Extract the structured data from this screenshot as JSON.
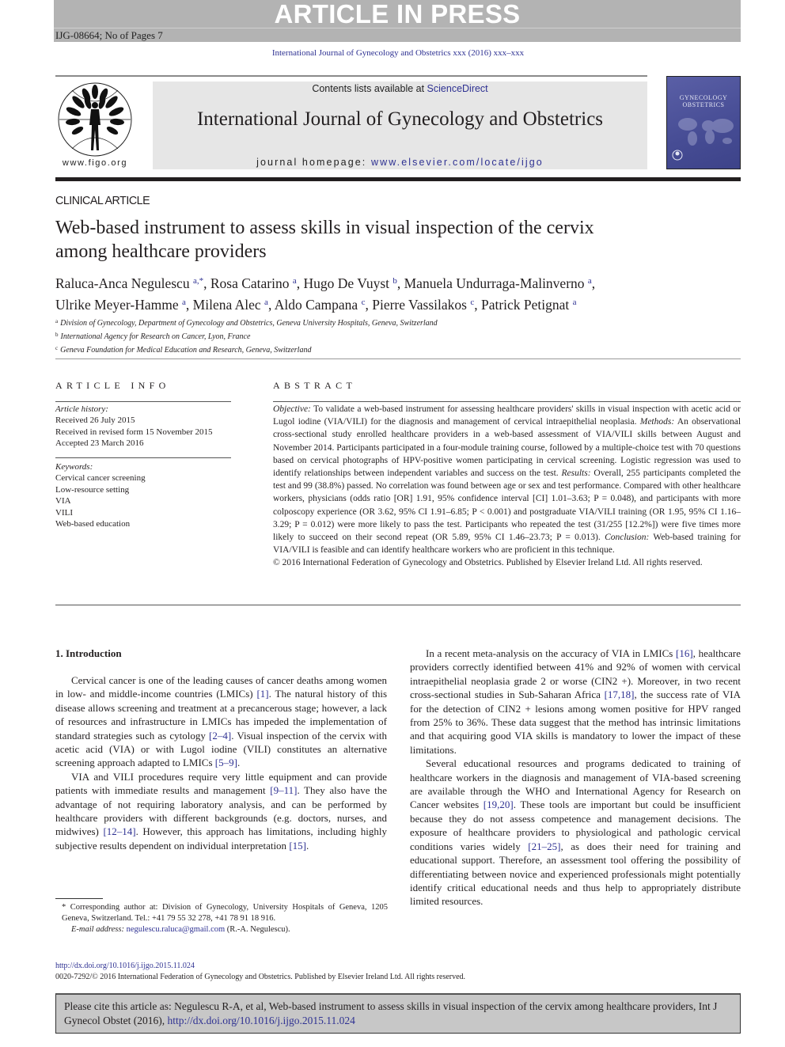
{
  "banner": {
    "article_in_press": "ARTICLE IN PRESS",
    "manuscript_id": "IJG-08664; No of Pages 7"
  },
  "journal_ref": "International Journal of Gynecology and Obstetrics xxx (2016) xxx–xxx",
  "header": {
    "figo_url": "www.figo.org",
    "contents_prefix": "Contents lists available at ",
    "contents_link": "ScienceDirect",
    "journal_title": "International Journal of Gynecology and Obstetrics",
    "homepage_prefix": "journal homepage: ",
    "homepage_link": "www.elsevier.com/locate/ijgo",
    "cover_line1": "GYNECOLOGY",
    "cover_line2": "OBSTETRICS"
  },
  "article": {
    "type": "CLINICAL ARTICLE",
    "title_line1": "Web-based instrument to assess skills in visual inspection of the cervix",
    "title_line2": "among healthcare providers",
    "authors": [
      {
        "name": "Raluca-Anca Negulescu",
        "aff": "a,*"
      },
      {
        "name": "Rosa Catarino",
        "aff": "a"
      },
      {
        "name": "Hugo De Vuyst",
        "aff": "b"
      },
      {
        "name": "Manuela Undurraga-Malinverno",
        "aff": "a"
      },
      {
        "name": "Ulrike Meyer-Hamme",
        "aff": "a"
      },
      {
        "name": "Milena Alec",
        "aff": "a"
      },
      {
        "name": "Aldo Campana",
        "aff": "c"
      },
      {
        "name": "Pierre Vassilakos",
        "aff": "c"
      },
      {
        "name": "Patrick Petignat",
        "aff": "a"
      }
    ],
    "affiliations": [
      {
        "mark": "a",
        "text": "Division of Gynecology, Department of Gynecology and Obstetrics, Geneva University Hospitals, Geneva, Switzerland"
      },
      {
        "mark": "b",
        "text": "International Agency for Research on Cancer, Lyon, France"
      },
      {
        "mark": "c",
        "text": "Geneva Foundation for Medical Education and Research, Geneva, Switzerland"
      }
    ]
  },
  "article_info": {
    "heading": "ARTICLE INFO",
    "history_label": "Article history:",
    "history": [
      "Received 26 July 2015",
      "Received in revised form 15 November 2015",
      "Accepted 23 March 2016"
    ],
    "keywords_label": "Keywords:",
    "keywords": [
      "Cervical cancer screening",
      "Low-resource setting",
      "VIA",
      "VILI",
      "Web-based education"
    ]
  },
  "abstract": {
    "heading": "ABSTRACT",
    "objective_label": "Objective:",
    "objective": " To validate a web-based instrument for assessing healthcare providers' skills in visual inspection with acetic acid or Lugol iodine (VIA/VILI) for the diagnosis and management of cervical intraepithelial neoplasia.",
    "methods_label": "Methods:",
    "methods": " An observational cross-sectional study enrolled healthcare providers in a web-based assessment of VIA/VILI skills between August and November 2014. Participants participated in a four-module training course, followed by a multiple-choice test with 70 questions based on cervical photographs of HPV-positive women participating in cervical screening. Logistic regression was used to identify relationships between independent variables and success on the test.",
    "results_label": "Results:",
    "results": " Overall, 255 participants completed the test and 99 (38.8%) passed. No correlation was found between age or sex and test performance. Compared with other healthcare workers, physicians (odds ratio [OR] 1.91, 95% confidence interval [CI] 1.01–3.63; P = 0.048), and participants with more colposcopy experience (OR 3.62, 95% CI 1.91–6.85; P < 0.001) and postgraduate VIA/VILI training (OR 1.95, 95% CI 1.16–3.29; P = 0.012) were more likely to pass the test. Participants who repeated the test (31/255 [12.2%]) were five times more likely to succeed on their second repeat (OR 5.89, 95% CI 1.46–23.73; P = 0.013).",
    "conclusion_label": "Conclusion:",
    "conclusion": " Web-based training for VIA/VILI is feasible and can identify healthcare workers who are proficient in this technique.",
    "copyright": "© 2016 International Federation of Gynecology and Obstetrics. Published by Elsevier Ireland Ltd. All rights reserved."
  },
  "intro": {
    "heading": "1. Introduction",
    "p1": [
      {
        "t": "Cervical cancer is one of the leading causes of cancer deaths among women in low- and middle-income countries (LMICs) "
      },
      {
        "r": "[1]"
      },
      {
        "t": ". The natural history of this disease allows screening and treatment at a precancerous stage; however, a lack of resources and infrastructure in LMICs has impeded the implementation of standard strategies such as cytology "
      },
      {
        "r": "[2–4]"
      },
      {
        "t": ". Visual inspection of the cervix with acetic acid (VIA) or with Lugol iodine (VILI) constitutes an alternative screening approach adapted to LMICs "
      },
      {
        "r": "[5–9]"
      },
      {
        "t": "."
      }
    ],
    "p2": [
      {
        "t": "VIA and VILI procedures require very little equipment and can provide patients with immediate results and management "
      },
      {
        "r": "[9–11]"
      },
      {
        "t": ". They also have the advantage of not requiring laboratory analysis, and can be performed by healthcare providers with different backgrounds (e.g. doctors, nurses, and midwives) "
      },
      {
        "r": "[12–14]"
      },
      {
        "t": ". However, this approach has limitations, including highly subjective results dependent on individual interpretation "
      },
      {
        "r": "[15]"
      },
      {
        "t": "."
      }
    ],
    "p3": [
      {
        "t": "In a recent meta-analysis on the accuracy of VIA in LMICs "
      },
      {
        "r": "[16]"
      },
      {
        "t": ", healthcare providers correctly identified between 41% and 92% of women with cervical intraepithelial neoplasia grade 2 or worse (CIN2 +). Moreover, in two recent cross-sectional studies in Sub-Saharan Africa "
      },
      {
        "r": "[17,18]"
      },
      {
        "t": ", the success rate of VIA for the detection of CIN2 + lesions among women positive for HPV ranged from 25% to 36%. These data suggest that the method has intrinsic limitations and that acquiring good VIA skills is mandatory to lower the impact of these limitations."
      }
    ],
    "p4": [
      {
        "t": "Several educational resources and programs dedicated to training of healthcare workers in the diagnosis and management of VIA-based screening are available through the WHO and International Agency for Research on Cancer websites "
      },
      {
        "r": "[19,20]"
      },
      {
        "t": ". These tools are important but could be insufficient because they do not assess competence and management decisions. The exposure of healthcare providers to physiological and pathologic cervical conditions varies widely "
      },
      {
        "r": "[21–25]"
      },
      {
        "t": ", as does their need for training and educational support. Therefore, an assessment tool offering the possibility of differentiating between novice and experienced professionals might potentially identify critical educational needs and thus help to appropriately distribute limited resources."
      }
    ]
  },
  "footnote": {
    "corresponding": "* Corresponding author at: Division of Gynecology, University Hospitals of Geneva, 1205 Geneva, Switzerland. Tel.: +41 79 55 32 278, +41 78 91 18 916.",
    "email_label": "E-mail address: ",
    "email": "negulescu.raluca@gmail.com",
    "email_suffix": " (R.-A. Negulescu)."
  },
  "footer": {
    "doi": "http://dx.doi.org/10.1016/j.ijgo.2015.11.024",
    "issn": "0020-7292/© 2016 International Federation of Gynecology and Obstetrics. Published by Elsevier Ireland Ltd. All rights reserved.",
    "cite_text": "Please cite this article as: Negulescu R-A, et al, Web-based instrument to assess skills in visual inspection of the cervix among healthcare providers, Int J Gynecol Obstet (2016), ",
    "cite_link": "http://dx.doi.org/10.1016/j.ijgo.2015.11.024"
  }
}
